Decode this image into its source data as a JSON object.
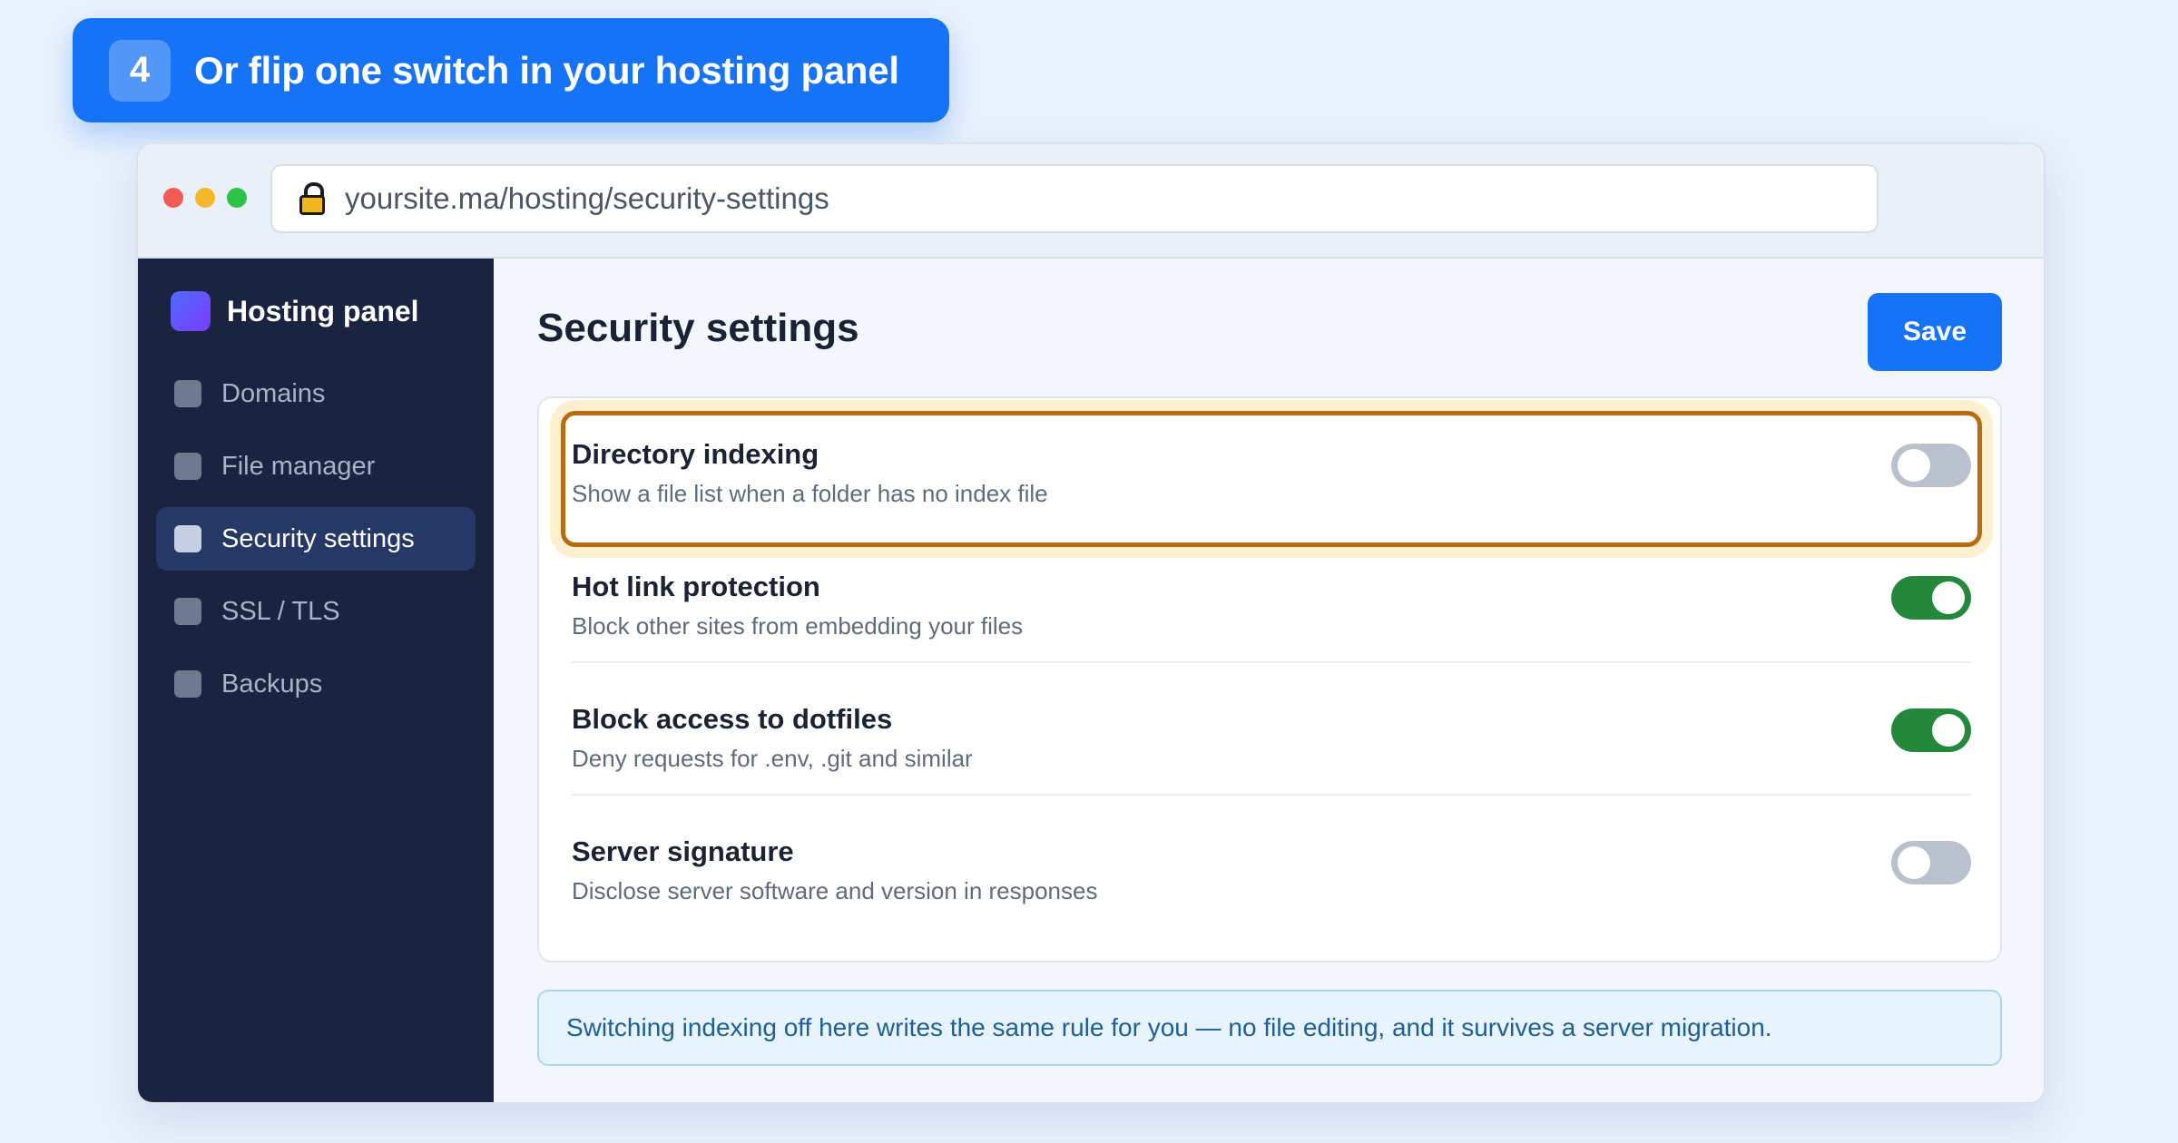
{
  "step": {
    "number": "4",
    "text": "Or flip one switch in your hosting panel"
  },
  "browser": {
    "url": "yoursite.ma/hosting/security-settings"
  },
  "sidebar": {
    "brand": "Hosting panel",
    "items": [
      {
        "label": "Domains",
        "active": false
      },
      {
        "label": "File manager",
        "active": false
      },
      {
        "label": "Security settings",
        "active": true
      },
      {
        "label": "SSL / TLS",
        "active": false
      },
      {
        "label": "Backups",
        "active": false
      }
    ]
  },
  "main": {
    "title": "Security settings",
    "save_label": "Save",
    "settings": [
      {
        "title": "Directory indexing",
        "description": "Show a file list when a folder has no index file",
        "enabled": false,
        "highlighted": true
      },
      {
        "title": "Hot link protection",
        "description": "Block other sites from embedding your files",
        "enabled": true,
        "highlighted": false
      },
      {
        "title": "Block access to dotfiles",
        "description": "Deny requests for .env, .git and similar",
        "enabled": true,
        "highlighted": false
      },
      {
        "title": "Server signature",
        "description": "Disclose server software and version in responses",
        "enabled": false,
        "highlighted": false
      }
    ],
    "info": "Switching indexing off here writes the same rule for you — no file editing, and it survives a server migration."
  },
  "colors": {
    "accent": "#1673f5",
    "sidebar": "#1a2440",
    "toggle_on": "#24883c",
    "toggle_off": "#b9c1cc",
    "highlight": "#b86b11"
  }
}
